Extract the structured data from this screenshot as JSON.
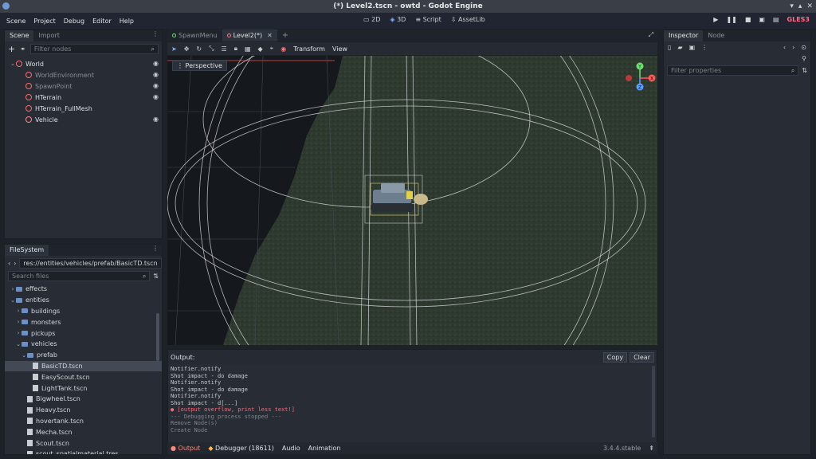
{
  "window": {
    "title": "(*) Level2.tscn - owtd - Godot Engine"
  },
  "menu": {
    "items": [
      "Scene",
      "Project",
      "Debug",
      "Editor",
      "Help"
    ]
  },
  "workspaces": [
    "2D",
    "3D",
    "Script",
    "AssetLib"
  ],
  "renderer": "GLES3",
  "scene_dock": {
    "tabs": [
      "Scene",
      "Import"
    ],
    "filter_placeholder": "Filter nodes",
    "nodes": [
      {
        "name": "World",
        "depth": 0,
        "icon_color": "#ff6b6b",
        "dim": false
      },
      {
        "name": "WorldEnvironment",
        "depth": 1,
        "icon_color": "#ff6b6b",
        "dim": true
      },
      {
        "name": "SpawnPoint",
        "depth": 1,
        "icon_color": "#ff6b6b",
        "dim": true
      },
      {
        "name": "HTerrain",
        "depth": 1,
        "icon_color": "#ff6b6b",
        "dim": false
      },
      {
        "name": "HTerrain_FullMesh",
        "depth": 1,
        "icon_color": "#ff6b6b",
        "dim": false
      },
      {
        "name": "Vehicle",
        "depth": 1,
        "icon_color": "#ff8a8a",
        "dim": false
      }
    ]
  },
  "filesystem": {
    "tab": "FileSystem",
    "path": "res://entities/vehicles/prefab/BasicTD.tscn",
    "search_placeholder": "Search files",
    "items": [
      {
        "name": "effects",
        "type": "folder",
        "depth": 1,
        "arrow": "›"
      },
      {
        "name": "entities",
        "type": "folder",
        "depth": 1,
        "arrow": "⌄"
      },
      {
        "name": "buildings",
        "type": "folder",
        "depth": 2,
        "arrow": "›"
      },
      {
        "name": "monsters",
        "type": "folder",
        "depth": 2,
        "arrow": "›"
      },
      {
        "name": "pickups",
        "type": "folder",
        "depth": 2,
        "arrow": "›"
      },
      {
        "name": "vehicles",
        "type": "folder",
        "depth": 2,
        "arrow": "⌄"
      },
      {
        "name": "prefab",
        "type": "folder",
        "depth": 3,
        "arrow": "⌄"
      },
      {
        "name": "BasicTD.tscn",
        "type": "file",
        "depth": 4,
        "arrow": ""
      },
      {
        "name": "EasyScout.tscn",
        "type": "file",
        "depth": 4,
        "arrow": ""
      },
      {
        "name": "LightTank.tscn",
        "type": "file",
        "depth": 4,
        "arrow": ""
      },
      {
        "name": "Bigwheel.tscn",
        "type": "file",
        "depth": 3,
        "arrow": ""
      },
      {
        "name": "Heavy.tscn",
        "type": "file",
        "depth": 3,
        "arrow": ""
      },
      {
        "name": "hovertank.tscn",
        "type": "file",
        "depth": 3,
        "arrow": ""
      },
      {
        "name": "Mecha.tscn",
        "type": "file",
        "depth": 3,
        "arrow": ""
      },
      {
        "name": "Scout.tscn",
        "type": "file",
        "depth": 3,
        "arrow": ""
      },
      {
        "name": "scout_spatialmaterial.tres",
        "type": "file",
        "depth": 3,
        "arrow": ""
      }
    ],
    "selected": "BasicTD.tscn"
  },
  "editor_tabs": [
    "SpawnMenu",
    "Level2(*)"
  ],
  "toolbar": {
    "transform": "Transform",
    "view": "View"
  },
  "viewport": {
    "label": "Perspective"
  },
  "output": {
    "title": "Output:",
    "copy": "Copy",
    "clear": "Clear",
    "lines": [
      {
        "text": "Notifier.notify",
        "kind": "normal"
      },
      {
        "text": "Shot impact - do damage",
        "kind": "normal"
      },
      {
        "text": "Notifier.notify",
        "kind": "normal"
      },
      {
        "text": "Shot impact - do damage",
        "kind": "normal"
      },
      {
        "text": "Notifier.notify",
        "kind": "normal"
      },
      {
        "text": "Shot impact - d[...]",
        "kind": "normal"
      },
      {
        "text": "● [output overflow, print less text!]",
        "kind": "err"
      },
      {
        "text": "--- Debugging process stopped ---",
        "kind": "dim"
      },
      {
        "text": "Remove Node(s)",
        "kind": "dim"
      },
      {
        "text": "Create Node",
        "kind": "dim"
      }
    ]
  },
  "bottom_tabs": [
    "Output",
    "Debugger (18611)",
    "Audio",
    "Animation"
  ],
  "version": "3.4.4.stable",
  "inspector": {
    "tabs": [
      "Inspector",
      "Node"
    ],
    "filter_placeholder": "Filter properties"
  },
  "gizmo": {
    "x": "X",
    "y": "Y",
    "z": "Z"
  }
}
